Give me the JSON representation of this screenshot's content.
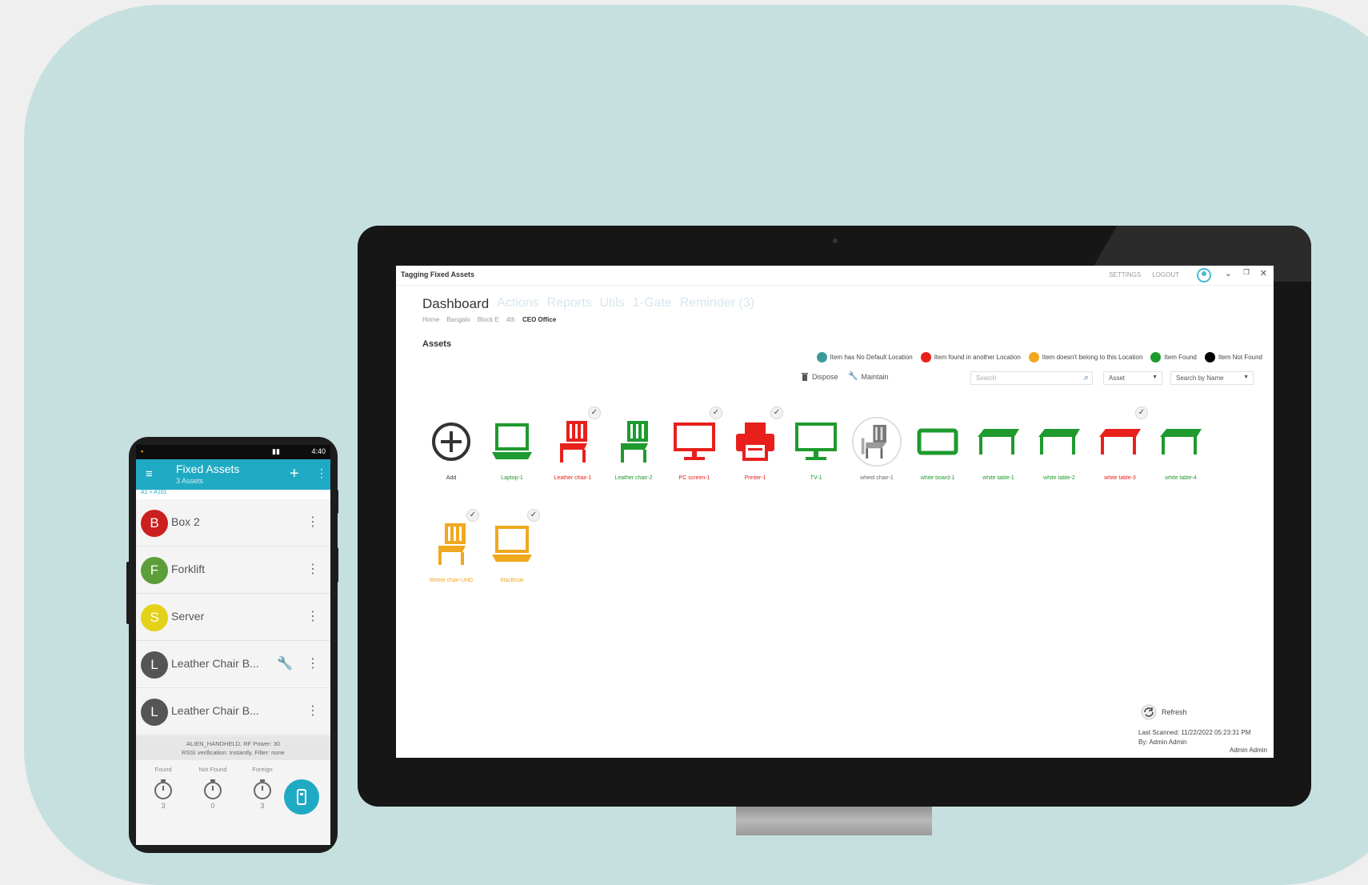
{
  "desktop": {
    "app_title": "Tagging Fixed Assets",
    "titlebar_links": [
      "SETTINGS",
      "LOGOUT"
    ],
    "nav_tabs": [
      "Dashboard",
      "Actions",
      "Reports",
      "Utils",
      "1-Gate",
      "Reminder (3)"
    ],
    "breadcrumb": [
      "Home",
      "Bangalo",
      "Block E",
      "4th",
      "CEO Office"
    ],
    "section_title": "Assets",
    "legend": [
      {
        "label": "Item has No Default Location",
        "color": "#3a9a9a"
      },
      {
        "label": "Item found in another Location",
        "color": "#e8201c"
      },
      {
        "label": "Item doesn't belong to this Location",
        "color": "#f0a81e"
      },
      {
        "label": "Item Found",
        "color": "#1e9a2e"
      },
      {
        "label": "Item Not Found",
        "color": "#000000"
      }
    ],
    "toolbar": {
      "dispose_label": "Dispose",
      "maintain_label": "Maintain",
      "search_placeholder": "Search",
      "filter_value": "Asset",
      "search_by_value": "Search by Name"
    },
    "assets": [
      {
        "name": "Add",
        "icon": "add-icon",
        "color": "#333333",
        "checked": false
      },
      {
        "name": "Laptop-1",
        "icon": "laptop-icon",
        "color": "#1e9a2e",
        "checked": false
      },
      {
        "name": "Leather chair-1",
        "icon": "chair-icon",
        "color": "#e8201c",
        "checked": true
      },
      {
        "name": "Leather chair-2",
        "icon": "chair-icon",
        "color": "#1e9a2e",
        "checked": false
      },
      {
        "name": "PC screen-1",
        "icon": "monitor-icon",
        "color": "#e8201c",
        "checked": true
      },
      {
        "name": "Printer-1",
        "icon": "printer-icon",
        "color": "#e8201c",
        "checked": true
      },
      {
        "name": "TV-1",
        "icon": "monitor-icon",
        "color": "#1e9a2e",
        "checked": false
      },
      {
        "name": "wheel chair-1",
        "icon": "photo-chair-icon",
        "color": "#666666",
        "checked": false
      },
      {
        "name": "white board-1",
        "icon": "whiteboard-icon",
        "color": "#1e9a2e",
        "checked": false
      },
      {
        "name": "white table-1",
        "icon": "table-icon",
        "color": "#1e9a2e",
        "checked": false
      },
      {
        "name": "white table-2",
        "icon": "table-icon",
        "color": "#1e9a2e",
        "checked": false
      },
      {
        "name": "white table-3",
        "icon": "table-icon",
        "color": "#e8201c",
        "checked": true
      },
      {
        "name": "white table-4",
        "icon": "table-icon",
        "color": "#1e9a2e",
        "checked": false
      },
      {
        "name": "Wheel chair-UHD",
        "icon": "chair-icon",
        "color": "#f0a81e",
        "checked": true
      },
      {
        "name": "MacBook",
        "icon": "laptop-icon",
        "color": "#f0a81e",
        "checked": true
      }
    ],
    "refresh_label": "Refresh",
    "last_scanned": "Last Scanned: 11/22/2022 05:23:31 PM",
    "scanned_by": "By: Admin Admin",
    "current_user": "Admin Admin"
  },
  "mobile": {
    "status_time": "4:40",
    "title": "Fixed Assets",
    "subtitle": "3 Assets",
    "path": "A1 > A101",
    "items": [
      {
        "initial": "B",
        "label": "Box 2",
        "color": "#cc1f1f",
        "wrench": false
      },
      {
        "initial": "F",
        "label": "Forklift",
        "color": "#5b9e3a",
        "wrench": false
      },
      {
        "initial": "S",
        "label": "Server",
        "color": "#e4d21a",
        "wrench": false
      },
      {
        "initial": "L",
        "label": "Leather Chair B...",
        "color": "#555555",
        "wrench": true
      },
      {
        "initial": "L",
        "label": "Leather Chair B...",
        "color": "#555555",
        "wrench": false
      }
    ],
    "info_line1": "ALIEN_HANDHELD, RF Power: 30",
    "info_line2": "RSSI verification: Instantly. Filter: none",
    "stats": [
      {
        "label": "Found",
        "value": "3"
      },
      {
        "label": "Not Found",
        "value": "0"
      },
      {
        "label": "Foreign",
        "value": "3"
      }
    ]
  }
}
